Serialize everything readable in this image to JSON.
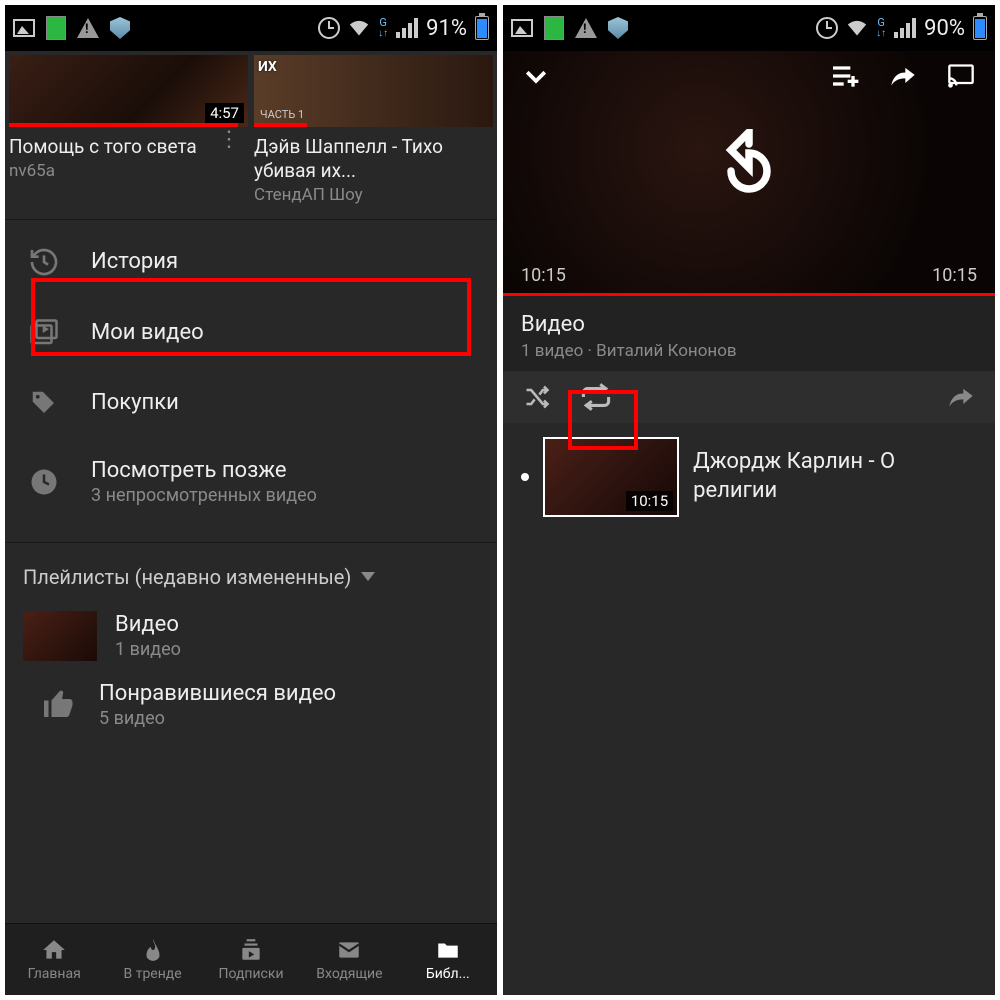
{
  "left": {
    "status": {
      "battery": "91%"
    },
    "videos": [
      {
        "title": "Помощь с того света",
        "channel": "nv65a",
        "duration": "4:57"
      },
      {
        "title": "Дэйв Шаппелл - Тихо убивая их...",
        "channel": "СтендАП Шоу",
        "overlay": "ИХ",
        "part": "ЧАСТЬ 1"
      }
    ],
    "library": {
      "history": "История",
      "my_videos": "Мои видео",
      "purchases": "Покупки",
      "watch_later": "Посмотреть позже",
      "watch_later_sub": "3 непросмотренных видео"
    },
    "playlists_header": "Плейлисты (недавно измененные)",
    "playlists": [
      {
        "title": "Видео",
        "sub": "1 видео"
      },
      {
        "title": "Понравившиеся видео",
        "sub": "5 видео"
      }
    ],
    "nav": {
      "home": "Главная",
      "trending": "В тренде",
      "subs": "Подписки",
      "inbox": "Входящие",
      "library": "Библ..."
    }
  },
  "right": {
    "status": {
      "battery": "90%"
    },
    "player": {
      "current": "10:15",
      "total": "10:15"
    },
    "playlist": {
      "title": "Видео",
      "sub": "1 видео · Виталий Кононов"
    },
    "video": {
      "title": "Джордж Карлин - О религии",
      "duration": "10:15"
    }
  }
}
